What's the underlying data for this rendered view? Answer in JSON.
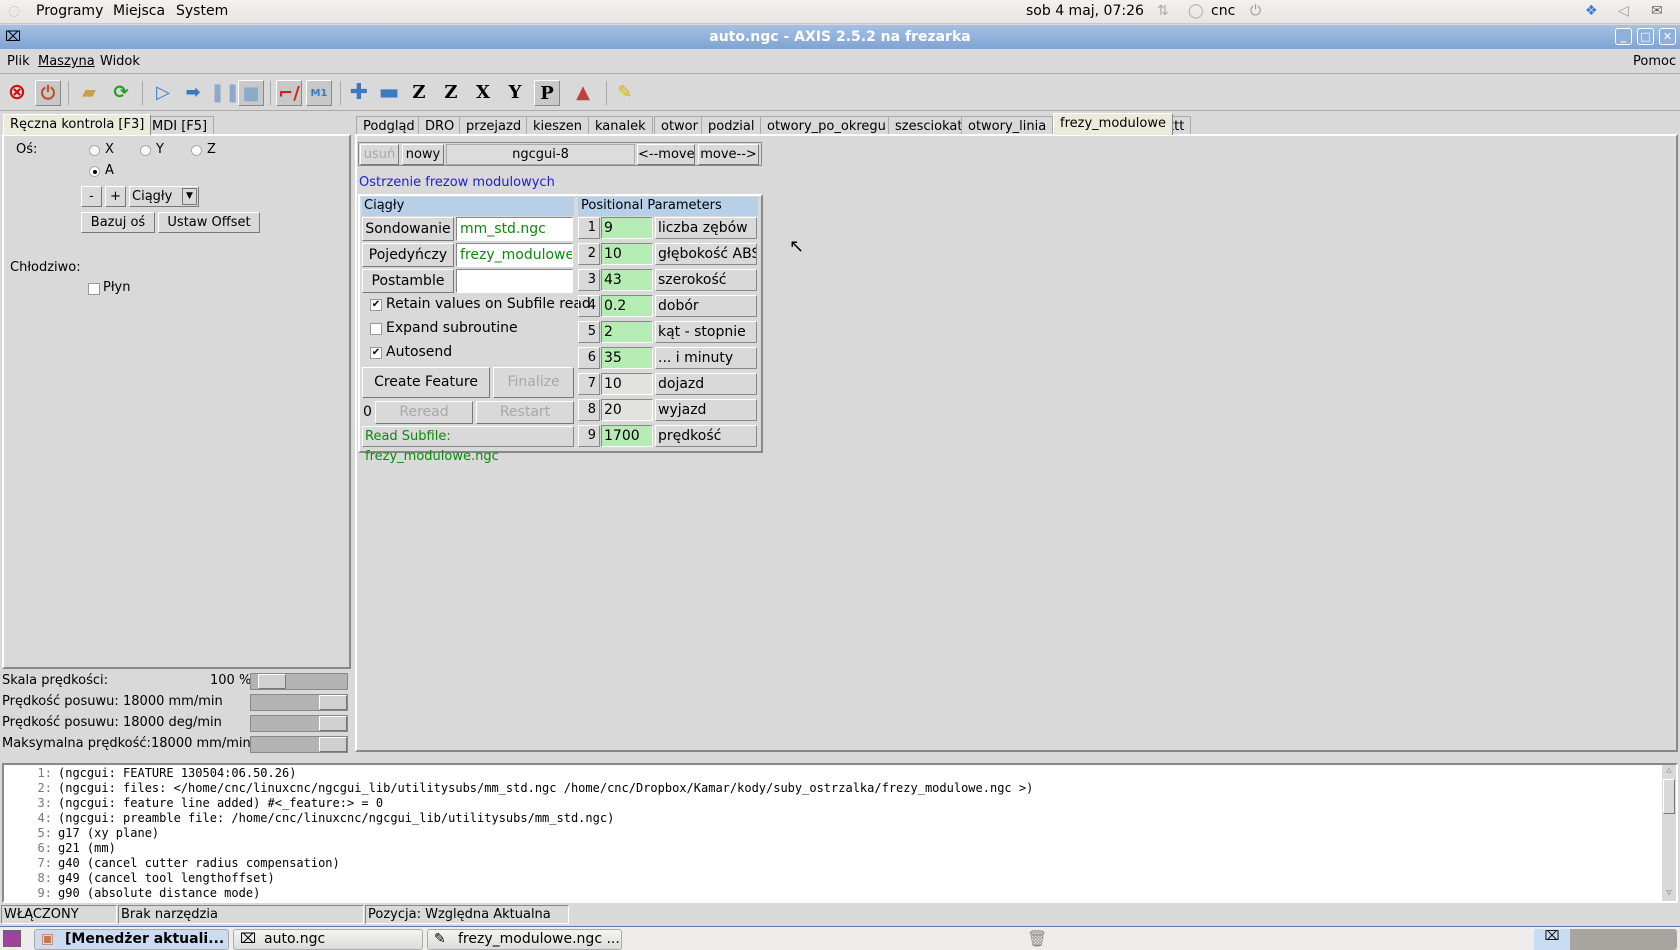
{
  "top_panel": {
    "menus": [
      "Programy",
      "Miejsca",
      "System"
    ],
    "clock": "sob  4 maj, 07:26",
    "user": "cnc"
  },
  "window": {
    "title": "auto.ngc - AXIS 2.5.2 na frezarka"
  },
  "menubar": {
    "items": [
      "Plik",
      "Maszyna",
      "Widok"
    ],
    "help": "Pomoc"
  },
  "toolbar": {
    "icons": [
      "estop-icon",
      "power-icon",
      "open-file-icon",
      "reload-icon",
      "run-icon",
      "step-icon",
      "pause-icon",
      "stop-icon",
      "block-delete-icon",
      "optional-stop-icon",
      "zoom-in-icon",
      "zoom-out-icon",
      "view-z-icon",
      "view-z2-icon",
      "view-x-icon",
      "view-y-icon",
      "view-p-icon",
      "rotate-view-icon",
      "clear-plot-icon"
    ],
    "labels": {
      "z": "Z",
      "z2": "Z",
      "x": "X",
      "y": "Y",
      "p": "P",
      "m1": "M1"
    }
  },
  "left_tabs": [
    "Ręczna kontrola [F3]",
    "MDI [F5]"
  ],
  "manual": {
    "axis_label": "Oś:",
    "axes": [
      "X",
      "Y",
      "Z",
      "A"
    ],
    "selected_axis": "A",
    "minus": "-",
    "plus": "+",
    "jog_mode": "Ciągły",
    "home_button": "Bazuj oś",
    "offset_button": "Ustaw Offset",
    "coolant_label": "Chłodziwo:",
    "flood_label": "Płyn",
    "flood_checked": false
  },
  "sliders": [
    {
      "label": "Skala prędkości:",
      "value": "100 %",
      "fraction": 0.1
    },
    {
      "label": "Prędkość posuwu:",
      "value": "18000 mm/min",
      "fraction": 1.0
    },
    {
      "label": "Prędkość posuwu:",
      "value": "18000 deg/min",
      "fraction": 1.0
    },
    {
      "label": "Maksymalna prędkość:",
      "value": "18000 mm/min",
      "fraction": 1.0
    }
  ],
  "right_tabs": [
    "Podgląd",
    "DRO",
    "przejazd",
    "kieszen",
    "kanalek",
    "otwor",
    "podzial",
    "otwory_po_okregu",
    "szesciokat",
    "otwory_linia",
    "frezy_modulowe",
    "ttt"
  ],
  "active_right_tab": "frezy_modulowe",
  "ngcgui": {
    "remove": "usuń",
    "new": "nowy",
    "name": "ngcgui-8",
    "move_left": "<--move",
    "move_right": "move-->",
    "subtitle": "Ostrzenie frezow modulowych",
    "mode_header": "Ciągły",
    "preamble_button": "Sondowanie",
    "preamble_file": "mm_std.ngc",
    "subfile_button": "Pojedyńczy",
    "subfile_file": "frezy_modulowe.r",
    "postamble_button": "Postamble",
    "postamble_file": "",
    "options": [
      {
        "label": "Retain values on Subfile read",
        "checked": true
      },
      {
        "label": "Expand subroutine",
        "checked": false
      },
      {
        "label": "Autosend",
        "checked": true
      }
    ],
    "create_feature": "Create Feature",
    "finalize": "Finalize",
    "count": "0",
    "reread": "Reread",
    "restart": "Restart",
    "status": "Read Subfile: frezy_modulowe.ngc",
    "params_header": "Positional Parameters",
    "params": [
      {
        "n": "1",
        "value": "9",
        "name": "liczba zębów",
        "highlight": true
      },
      {
        "n": "2",
        "value": "10",
        "name": "głębokość ABS",
        "highlight": true
      },
      {
        "n": "3",
        "value": "43",
        "name": "szerokość",
        "highlight": true
      },
      {
        "n": "4",
        "value": "0.2",
        "name": "dobór",
        "highlight": true
      },
      {
        "n": "5",
        "value": "2",
        "name": "kąt - stopnie",
        "highlight": true
      },
      {
        "n": "6",
        "value": "35",
        "name": "... i minuty",
        "highlight": true
      },
      {
        "n": "7",
        "value": "10",
        "name": "dojazd",
        "highlight": false
      },
      {
        "n": "8",
        "value": "20",
        "name": "wyjazd",
        "highlight": false
      },
      {
        "n": "9",
        "value": "1700",
        "name": "prędkość",
        "highlight": true
      }
    ]
  },
  "gcode": [
    {
      "n": "1:",
      "text": "(ngcgui: FEATURE 130504:06.50.26)"
    },
    {
      "n": "2:",
      "text": "(ngcgui: files: </home/cnc/linuxcnc/ngcgui_lib/utilitysubs/mm_std.ngc /home/cnc/Dropbox/Kamar/kody/suby_ostrzalka/frezy_modulowe.ngc >)"
    },
    {
      "n": "3:",
      "text": "(ngcgui: feature line added) #<_feature:> = 0"
    },
    {
      "n": "4:",
      "text": "(ngcgui: preamble file: /home/cnc/linuxcnc/ngcgui_lib/utilitysubs/mm_std.ngc)"
    },
    {
      "n": "5:",
      "text": "g17 (xy plane)"
    },
    {
      "n": "6:",
      "text": "g21 (mm)"
    },
    {
      "n": "7:",
      "text": "g40 (cancel cutter radius compensation)"
    },
    {
      "n": "8:",
      "text": "g49 (cancel tool lengthoffset)"
    },
    {
      "n": "9:",
      "text": "g90 (absolute distance mode)"
    }
  ],
  "statusbar": {
    "state": "WŁĄCZONY",
    "tool": "Brak narzędzia",
    "position": "Pozycja: Względna Aktualna"
  },
  "taskbar": {
    "tasks": [
      "[Menedżer aktuali...",
      "auto.ngc",
      "frezy_modulowe.ngc ..."
    ]
  },
  "colors": {
    "title_bar": "#7fa3d3",
    "param_highlight": "#b4ecb4",
    "file_text": "#0a8a0a",
    "subtitle": "#2020d0",
    "header": "#b8cfe8"
  }
}
